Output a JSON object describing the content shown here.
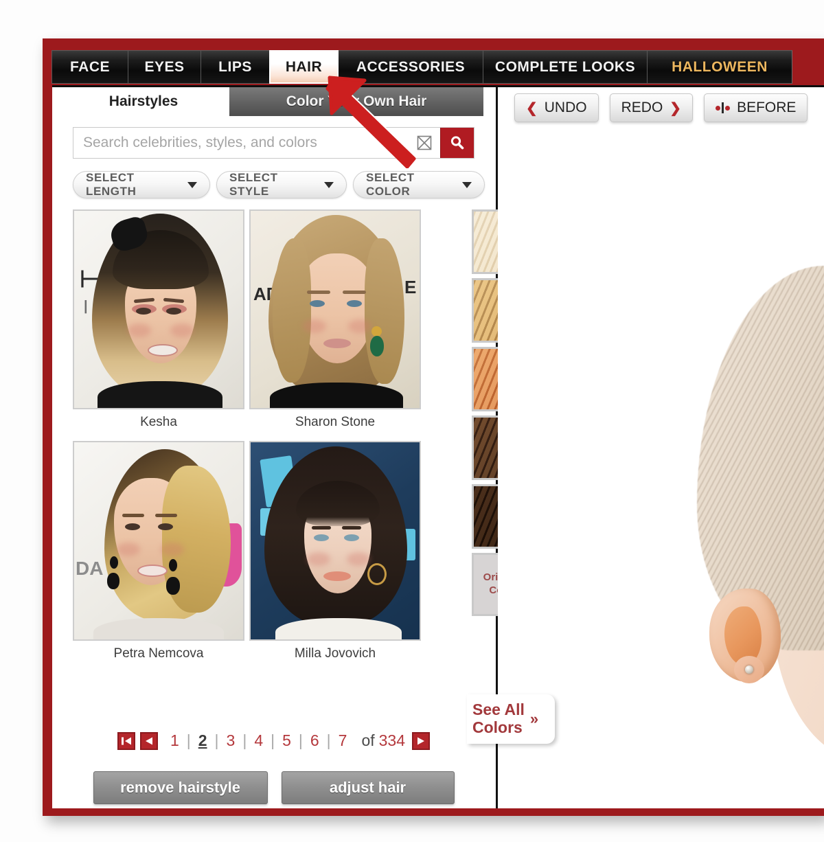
{
  "app": {
    "frame_color": "#9d1a1d",
    "accent_red": "#b4262b",
    "halloween_color": "#edb75f"
  },
  "navbar": {
    "tabs": [
      {
        "label": "FACE",
        "active": false
      },
      {
        "label": "EYES",
        "active": false
      },
      {
        "label": "LIPS",
        "active": false
      },
      {
        "label": "HAIR",
        "active": true
      },
      {
        "label": "ACCESSORIES",
        "active": false
      },
      {
        "label": "COMPLETE LOOKS",
        "active": false
      },
      {
        "label": "HALLOWEEN",
        "active": false
      }
    ]
  },
  "subtabs": [
    {
      "label": "Hairstyles",
      "active": true
    },
    {
      "label": "Color Your Own Hair",
      "active": false
    }
  ],
  "search": {
    "value": "",
    "placeholder": "Search celebrities, styles, and colors",
    "clear_icon": "close-x-icon",
    "search_icon": "magnifier-icon"
  },
  "filters": [
    {
      "label": "SELECT LENGTH",
      "icon": "chevron-down-icon"
    },
    {
      "label": "SELECT STYLE",
      "icon": "chevron-down-icon"
    },
    {
      "label": "SELECT COLOR",
      "icon": "chevron-down-icon"
    }
  ],
  "thumbnails": [
    {
      "name": "Kesha"
    },
    {
      "name": "Sharon Stone"
    },
    {
      "name": "Petra Nemcova"
    },
    {
      "name": "Milla Jovovich"
    }
  ],
  "color_swatches": [
    {
      "name": "platinum-blonde",
      "hex": "#e9d8b8"
    },
    {
      "name": "golden-blonde",
      "hex": "#d9a866"
    },
    {
      "name": "copper-red",
      "hex": "#c9763c"
    },
    {
      "name": "medium-brown",
      "hex": "#4a2c1a"
    },
    {
      "name": "dark-brown",
      "hex": "#2e1a0f"
    }
  ],
  "original_color": {
    "line1": "Original",
    "line2": "Color"
  },
  "see_all_colors": {
    "line1": "See All",
    "line2": "Colors",
    "chevron": "»"
  },
  "pagination": {
    "first_icon": "first-page-icon",
    "prev_icon": "previous-page-icon",
    "next_icon": "next-page-icon",
    "separator": "|",
    "pages": [
      "1",
      "2",
      "3",
      "4",
      "5",
      "6",
      "7"
    ],
    "current_page": "2",
    "of_label": "of",
    "total_pages": "334"
  },
  "actions": [
    {
      "label": "remove hairstyle"
    },
    {
      "label": "adjust hair"
    }
  ],
  "preview_toolbar": [
    {
      "label": "UNDO",
      "icon": "chevron-left-icon",
      "icon_side": "left"
    },
    {
      "label": "REDO",
      "icon": "chevron-right-icon",
      "icon_side": "right"
    },
    {
      "label": "BEFORE",
      "icon": "before-after-icon",
      "icon_side": "left"
    }
  ],
  "annotation": {
    "type": "arrow",
    "color": "#cc1f1f",
    "points_to": "HAIR"
  }
}
